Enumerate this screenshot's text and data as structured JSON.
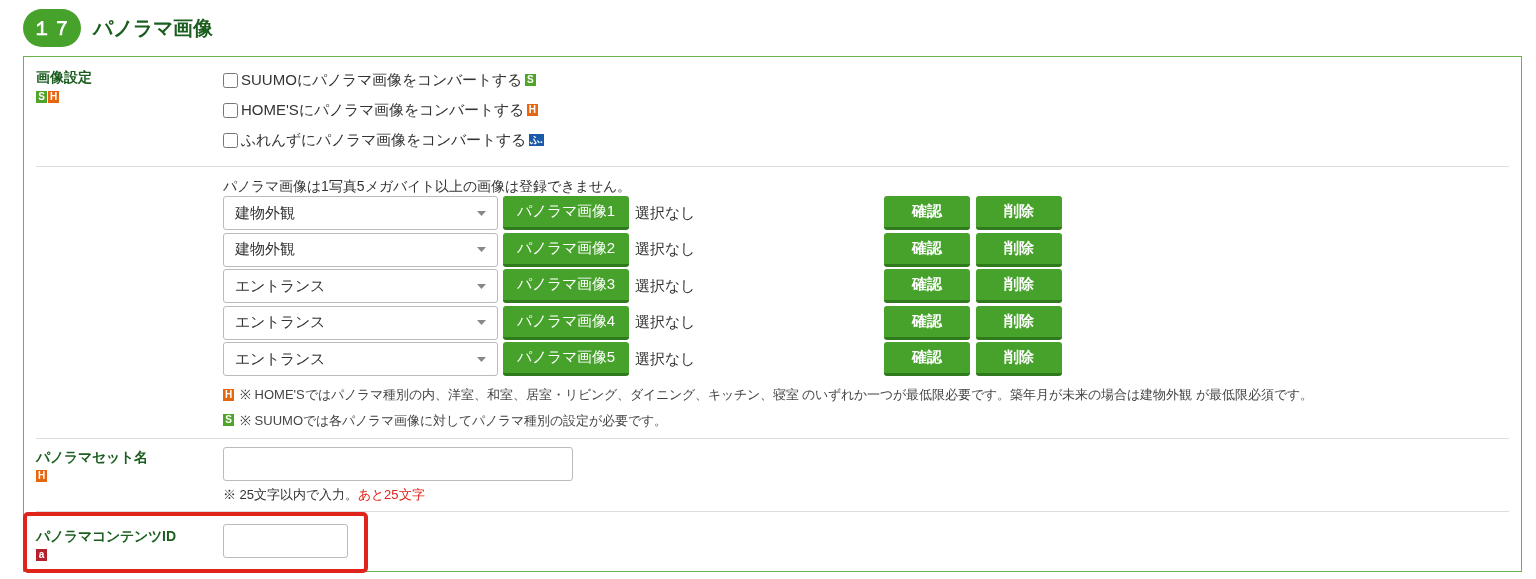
{
  "section": {
    "number": "１７",
    "title": "パノラマ画像"
  },
  "image_settings": {
    "label": "画像設定",
    "badges": [
      {
        "text": "S",
        "color": "#4fa52a"
      },
      {
        "text": "H",
        "color": "#e8650f"
      }
    ],
    "options": [
      {
        "label": "SUUMOにパノラマ画像をコンバートする",
        "checked": false,
        "badge": {
          "text": "S",
          "color": "#4fa52a"
        }
      },
      {
        "label": "HOME'Sにパノラマ画像をコンバートする",
        "checked": false,
        "badge": {
          "text": "H",
          "color": "#e8650f"
        }
      },
      {
        "label": "ふれんずにパノラマ画像をコンバートする",
        "checked": false,
        "badge": {
          "text": "ふ.",
          "color": "#1a5aa8"
        }
      }
    ]
  },
  "images": {
    "note": "パノラマ画像は1写真5メガバイト以上の画像は登録できません。",
    "rows": [
      {
        "type": "建物外観",
        "upload": "パノラマ画像1",
        "file": "選択なし",
        "confirm": "確認",
        "delete": "削除"
      },
      {
        "type": "建物外観",
        "upload": "パノラマ画像2",
        "file": "選択なし",
        "confirm": "確認",
        "delete": "削除"
      },
      {
        "type": "エントランス",
        "upload": "パノラマ画像3",
        "file": "選択なし",
        "confirm": "確認",
        "delete": "削除"
      },
      {
        "type": "エントランス",
        "upload": "パノラマ画像4",
        "file": "選択なし",
        "confirm": "確認",
        "delete": "削除"
      },
      {
        "type": "エントランス",
        "upload": "パノラマ画像5",
        "file": "選択なし",
        "confirm": "確認",
        "delete": "削除"
      }
    ],
    "notes": [
      {
        "badge": {
          "text": "H",
          "color": "#e8650f"
        },
        "text": "※ HOME'Sではパノラマ種別の内、洋室、和室、居室・リビング、ダイニング、キッチン、寝室 のいずれか一つが最低限必要です。築年月が未来の場合は建物外観 が最低限必須です。"
      },
      {
        "badge": {
          "text": "S",
          "color": "#4fa52a"
        },
        "text": "※ SUUMOでは各パノラマ画像に対してパノラマ種別の設定が必要です。"
      }
    ]
  },
  "set_name": {
    "label": "パノラマセット名",
    "badge": {
      "text": "H",
      "color": "#e8650f"
    },
    "hint": "※ 25文字以内で入力。",
    "remaining": "あと25文字",
    "highlighted": false
  },
  "content_id": {
    "label": "パノラマコンテンツID",
    "badge": {
      "text": "a",
      "color": "#b5202e"
    },
    "highlighted": true
  }
}
